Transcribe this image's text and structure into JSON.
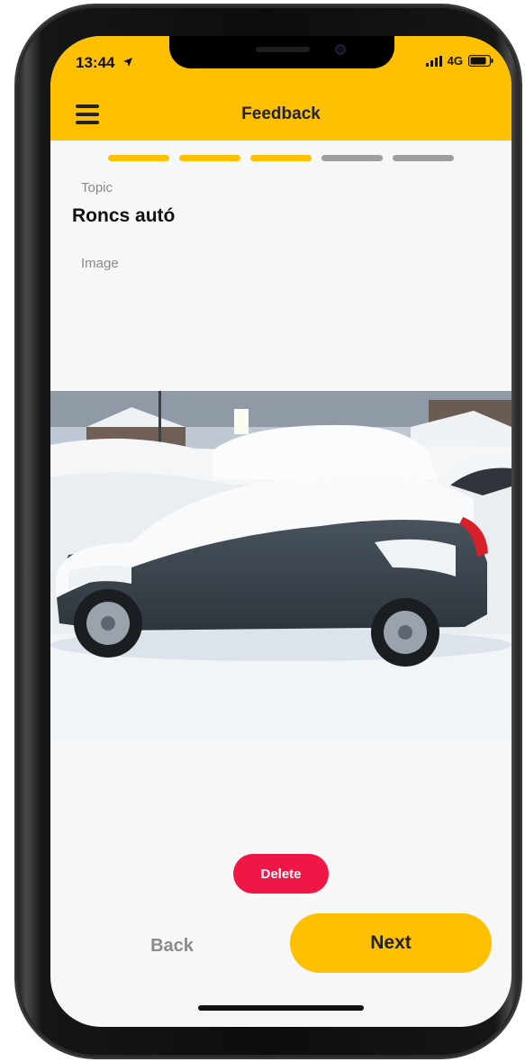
{
  "status_bar": {
    "time": "13:44",
    "network": "4G",
    "location_icon": "location-arrow-icon",
    "signal_icon": "signal-bars-icon",
    "battery_icon": "battery-icon"
  },
  "app_bar": {
    "title": "Feedback",
    "menu_icon": "hamburger-menu-icon",
    "background_color": "#fec000"
  },
  "progress": {
    "total_steps": 5,
    "completed_steps": 3,
    "active_color": "#fec000",
    "inactive_color": "#9e9e9e"
  },
  "form": {
    "topic_label": "Topic",
    "topic_value": "Roncs autó",
    "image_label": "Image"
  },
  "actions": {
    "delete_label": "Delete",
    "back_label": "Back",
    "next_label": "Next",
    "delete_color": "#ee1746",
    "next_color": "#fec000"
  }
}
